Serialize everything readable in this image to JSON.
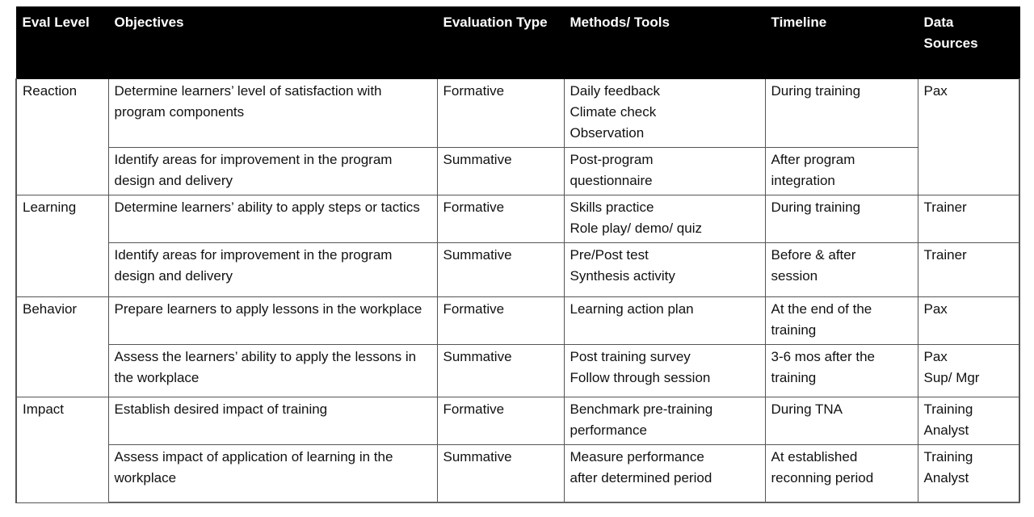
{
  "table": {
    "headers": [
      "Eval Level",
      "Objectives",
      "Evaluation Type",
      "Methods/ Tools",
      "Timeline",
      "Data\nSources"
    ],
    "rows": [
      {
        "level": "Reaction",
        "objective": "Determine learners’ level of satisfaction with program components",
        "type": "Formative",
        "methods": "Daily feedback\nClimate check\nObservation",
        "timeline": "During training",
        "sources": "Pax"
      },
      {
        "objective": "Identify areas for improvement in the program design and delivery",
        "type": "Summative",
        "methods": "Post-program\nquestionnaire",
        "timeline": "After program\nintegration"
      },
      {
        "level": "Learning",
        "objective": "Determine learners’ ability to apply steps or tactics",
        "type": "Formative",
        "methods": "Skills practice\nRole play/ demo/ quiz",
        "timeline": "During training",
        "sources": "Trainer"
      },
      {
        "objective": "Identify areas for improvement in the program design and delivery",
        "type": "Summative",
        "methods": "Pre/Post test\nSynthesis activity",
        "timeline": "Before & after\nsession",
        "sources": "Trainer"
      },
      {
        "level": "Behavior",
        "objective": "Prepare learners to apply lessons in the workplace",
        "type": "Formative",
        "methods": "Learning action plan",
        "timeline": "At the end of the\ntraining",
        "sources": "Pax"
      },
      {
        "objective": "Assess the learners’ ability to apply the lessons in the workplace",
        "type": "Summative",
        "methods": "Post training survey\nFollow through session",
        "timeline": "3-6 mos after the\ntraining",
        "sources": "Pax\nSup/ Mgr"
      },
      {
        "level": "Impact",
        "objective": "Establish desired impact of training",
        "type": "Formative",
        "methods": "Benchmark pre-training\nperformance",
        "timeline": "During TNA",
        "sources": "Training\nAnalyst"
      },
      {
        "objective": "Assess impact of application of learning in the workplace",
        "type": "Summative",
        "methods": "Measure performance\nafter determined period",
        "timeline": "At established\nreconning period",
        "sources": "Training\nAnalyst"
      }
    ]
  }
}
